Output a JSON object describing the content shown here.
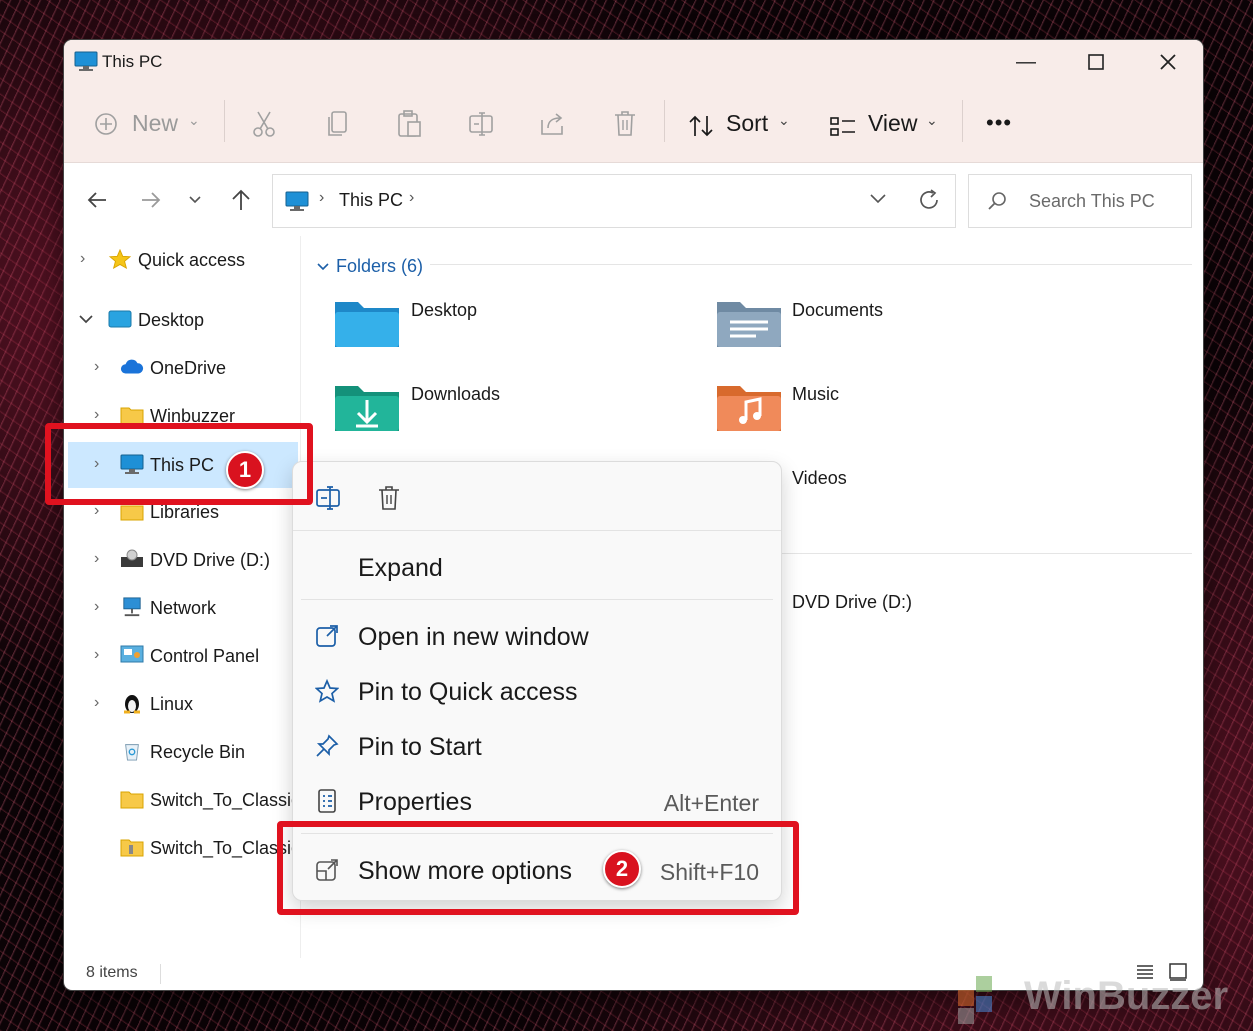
{
  "window": {
    "title": "This PC"
  },
  "toolbar": {
    "new_label": "New",
    "sort_label": "Sort",
    "view_label": "View",
    "more_label": "•••"
  },
  "address": {
    "path": "This PC",
    "search_placeholder": "Search This PC"
  },
  "sidebar": {
    "items": [
      {
        "label": "Quick access"
      },
      {
        "label": "Desktop"
      },
      {
        "label": "OneDrive"
      },
      {
        "label": "Winbuzzer"
      },
      {
        "label": "This PC"
      },
      {
        "label": "Libraries"
      },
      {
        "label": "DVD Drive (D:)"
      },
      {
        "label": "Network"
      },
      {
        "label": "Control Panel"
      },
      {
        "label": "Linux"
      },
      {
        "label": "Recycle Bin"
      },
      {
        "label": "Switch_To_Classic_"
      },
      {
        "label": "Switch_To_Classic_"
      }
    ]
  },
  "content": {
    "section_header": "Folders (6)",
    "folders": [
      {
        "label": "Desktop"
      },
      {
        "label": "Documents"
      },
      {
        "label": "Downloads"
      },
      {
        "label": "Music"
      },
      {
        "label": "Videos"
      }
    ],
    "drive_label": "DVD Drive (D:)"
  },
  "context_menu": {
    "items": [
      {
        "label": "Expand",
        "shortcut": ""
      },
      {
        "label": "Open in new window",
        "shortcut": ""
      },
      {
        "label": "Pin to Quick access",
        "shortcut": ""
      },
      {
        "label": "Pin to Start",
        "shortcut": ""
      },
      {
        "label": "Properties",
        "shortcut": "Alt+Enter"
      },
      {
        "label": "Show more options",
        "shortcut": "Shift+F10"
      }
    ]
  },
  "annotations": {
    "badge1": "1",
    "badge2": "2"
  },
  "status": {
    "items_count": "8 items"
  },
  "watermark": "WinBuzzer",
  "colors": {
    "accent_red": "#e0121f",
    "titlebar_bg": "#f8ece9",
    "selection_bg": "#cce8ff"
  }
}
